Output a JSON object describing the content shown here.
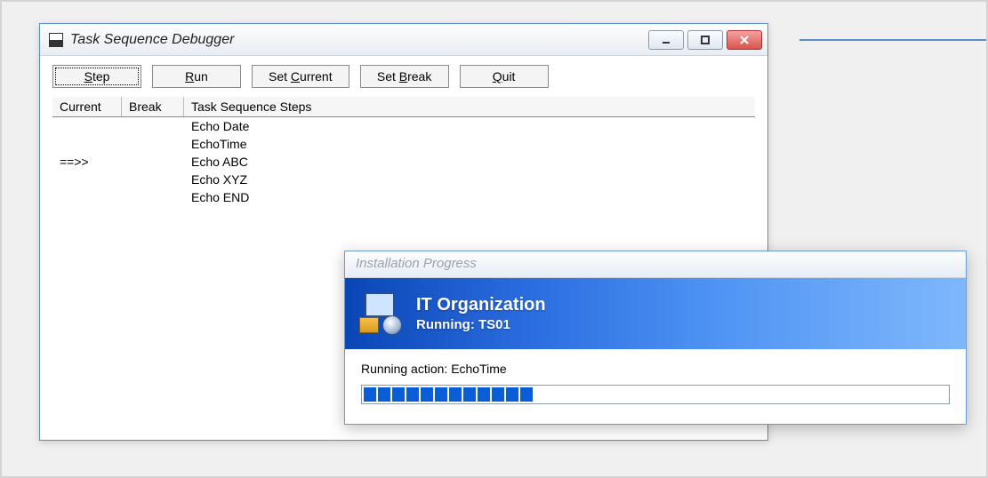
{
  "debugger": {
    "title": "Task Sequence Debugger",
    "toolbar": {
      "step": "Step",
      "run": "Run",
      "set_current": "Set Current",
      "set_break": "Set Break",
      "quit": "Quit"
    },
    "columns": {
      "current": "Current",
      "break": "Break",
      "steps": "Task Sequence Steps"
    },
    "rows": [
      {
        "current": "",
        "break": "",
        "step": "Echo Date"
      },
      {
        "current": "",
        "break": "",
        "step": "EchoTime"
      },
      {
        "current": "==>>",
        "break": "",
        "step": "Echo ABC"
      },
      {
        "current": "",
        "break": "",
        "step": "Echo XYZ"
      },
      {
        "current": "",
        "break": "",
        "step": "Echo END"
      }
    ]
  },
  "progress": {
    "window_title": "Installation Progress",
    "org": "IT Organization",
    "running_label": "Running: TS01",
    "action_prefix": "Running action: ",
    "action_name": "EchoTime",
    "blocks_filled": 12,
    "blocks_total": 40
  }
}
